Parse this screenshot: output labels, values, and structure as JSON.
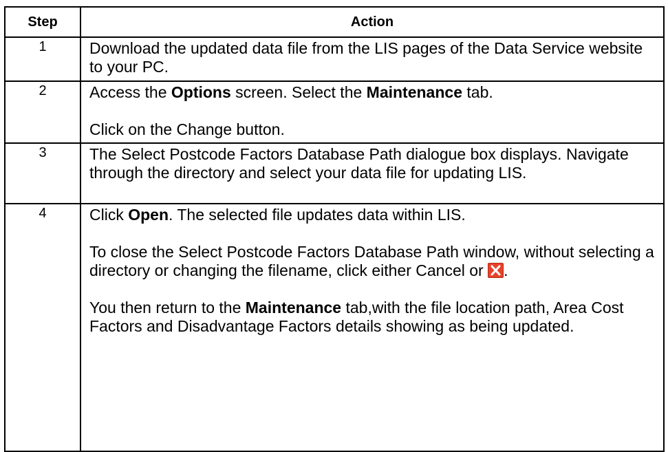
{
  "header": {
    "step": "Step",
    "action": "Action"
  },
  "rows": [
    {
      "step": "1",
      "text": "Download the updated data file from the LIS pages of the Data Service website to your PC."
    },
    {
      "step": "2",
      "line1_a": "Access the ",
      "line1_b": "Options",
      "line1_c": " screen. Select the ",
      "line1_d": "Maintenance",
      "line1_e": " tab.",
      "line2": "Click on the Change button."
    },
    {
      "step": "3",
      "text": "The Select Postcode Factors Database Path dialogue box displays.  Navigate through the directory and select your data file for updating LIS."
    },
    {
      "step": "4",
      "line1_a": "Click ",
      "line1_b": "Open",
      "line1_c": ". The selected file updates data within LIS.",
      "line2": "To close the Select Postcode Factors Database Path window, without selecting a directory or changing the filename, click either Cancel or ",
      "line2_end": ".",
      "line3_a": "You then return to the ",
      "line3_b": "Maintenance",
      "line3_c": " tab,with the file location path, Area Cost Factors and Disadvantage Factors details showing as being updated.",
      "icon": "close-icon",
      "icon_color": "#e8432a"
    }
  ]
}
